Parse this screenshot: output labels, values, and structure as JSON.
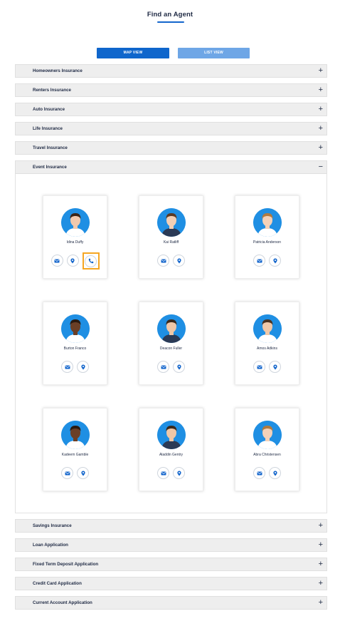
{
  "header": {
    "title": "Find an Agent"
  },
  "views": {
    "map_label": "MAP VIEW",
    "list_label": "LIST VIEW"
  },
  "accordion": {
    "items": [
      {
        "label": "Homeowners Insurance",
        "sign": "+"
      },
      {
        "label": "Renters Insurance",
        "sign": "+"
      },
      {
        "label": "Auto Insurance",
        "sign": "+"
      },
      {
        "label": "Life Insurance",
        "sign": "+"
      },
      {
        "label": "Travel Insurance",
        "sign": "+"
      },
      {
        "label": "Event Insurance",
        "sign": "−"
      },
      {
        "label": "Savings Insurance",
        "sign": "+"
      },
      {
        "label": "Loan Application",
        "sign": "+"
      },
      {
        "label": "Fixed Term Deposit Application",
        "sign": "+"
      },
      {
        "label": "Credit Card Application",
        "sign": "+"
      },
      {
        "label": "Current Account Application",
        "sign": "+"
      }
    ]
  },
  "agents": [
    {
      "name": "Idina Duffy",
      "icons": [
        "mail-icon",
        "location-pin-icon",
        "phone-icon"
      ],
      "skin": "#f1c9ad",
      "hair": "#3b2416",
      "shirt": "#ffffff"
    },
    {
      "name": "Kai Ratliff",
      "icons": [
        "mail-icon",
        "location-pin-icon"
      ],
      "skin": "#f2cfb5",
      "hair": "#5a3a24",
      "shirt": "#2b3a55"
    },
    {
      "name": "Patricia Anderson",
      "icons": [
        "mail-icon",
        "location-pin-icon"
      ],
      "skin": "#f3d1b8",
      "hair": "#b07a3f",
      "shirt": "#ffffff"
    },
    {
      "name": "Burton Franco",
      "icons": [
        "mail-icon",
        "location-pin-icon"
      ],
      "skin": "#6b3f26",
      "hair": "#2a1a10",
      "shirt": "#ffffff"
    },
    {
      "name": "Deacon Fuller",
      "icons": [
        "mail-icon",
        "location-pin-icon"
      ],
      "skin": "#efc7a7",
      "hair": "#3a2a1d",
      "shirt": "#2b3a55"
    },
    {
      "name": "Amos Adkins",
      "icons": [
        "mail-icon",
        "location-pin-icon"
      ],
      "skin": "#f0c8a8",
      "hair": "#4a3322",
      "shirt": "#ffffff"
    },
    {
      "name": "Kadeem Gamble",
      "icons": [
        "mail-icon",
        "location-pin-icon"
      ],
      "skin": "#6b3f26",
      "hair": "#2a1a10",
      "shirt": "#ffffff"
    },
    {
      "name": "Aladdin Gentry",
      "icons": [
        "mail-icon",
        "location-pin-icon"
      ],
      "skin": "#efc7a7",
      "hair": "#3a2a1d",
      "shirt": "#2b3a55"
    },
    {
      "name": "Abra Christensen",
      "icons": [
        "mail-icon",
        "location-pin-icon"
      ],
      "skin": "#f3d1b8",
      "hair": "#b07a3f",
      "shirt": "#ffffff"
    }
  ],
  "colors": {
    "accent": "#0f66cc",
    "accent_light": "#6ea6e6",
    "avatar_bg": "#1f8fe3",
    "focus": "#f5a623",
    "icon": "#1466cc"
  }
}
